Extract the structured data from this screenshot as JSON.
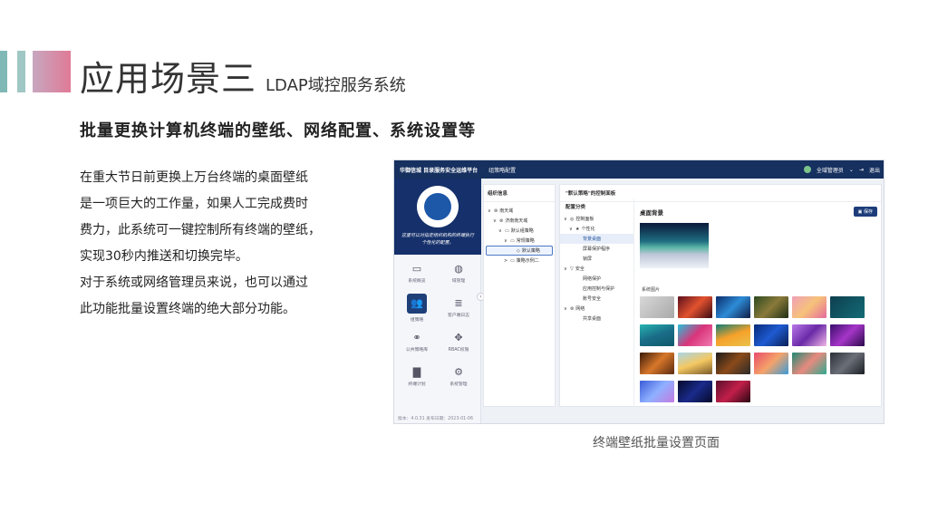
{
  "slide": {
    "title": "应用场景三",
    "title_sub": "LDAP域控服务系统",
    "subtitle": "批量更换计算机终端的壁纸、网络配置、系统设置等",
    "paragraphs": [
      "在重大节日前更换上万台终端的桌面壁纸",
      "是一项巨大的工作量，如果人工完成费时",
      "费力，此系统可一键控制所有终端的壁纸，",
      "实现30秒内推送和切换完毕。",
      "对于系统或网络管理员来说，也可以通过",
      "此功能批量设置终端的绝大部分功能。"
    ],
    "caption": "终端壁纸批量设置页面"
  },
  "app": {
    "brand": "华御信城   目录服务安全运维平台",
    "active_tab": "组策略配置",
    "user": "全域管理员",
    "logout": "退出",
    "slogan": "这里可以对指定组织机构的终端执行个性化的配置。",
    "nav": [
      {
        "icon": "monitor-icon",
        "glyph": "▭",
        "label": "系统概览",
        "active": false
      },
      {
        "icon": "globe-icon",
        "glyph": "◍",
        "label": "域管理",
        "active": false
      },
      {
        "icon": "users-icon",
        "glyph": "👥",
        "label": "组策略",
        "active": true
      },
      {
        "icon": "list-icon",
        "glyph": "≣",
        "label": "客户端日志",
        "active": false
      },
      {
        "icon": "cluster-icon",
        "glyph": "⚭",
        "label": "公共策略库",
        "active": false
      },
      {
        "icon": "move-icon",
        "glyph": "✥",
        "label": "RBAC权限",
        "active": false
      },
      {
        "icon": "file-icon",
        "glyph": "▇",
        "label": "终端计划",
        "active": false
      },
      {
        "icon": "gear-icon",
        "glyph": "⚙",
        "label": "系统管理",
        "active": false
      }
    ],
    "version": "版本：4.0.31   发布日期：2023-01-06",
    "tree_title": "组织信息",
    "tree": [
      {
        "indent": 0,
        "arrow": "∨",
        "icon": "⊜",
        "label": "南天域",
        "selected": false
      },
      {
        "indent": 1,
        "arrow": "∨",
        "icon": "⊜",
        "label": "济南南天域",
        "selected": false
      },
      {
        "indent": 2,
        "arrow": "∨",
        "icon": "▭",
        "label": "默认组策略",
        "selected": false
      },
      {
        "indent": 3,
        "arrow": "∨",
        "icon": "▭",
        "label": "常规策略",
        "selected": false
      },
      {
        "indent": 4,
        "arrow": "",
        "icon": "◇",
        "label": "默认策略",
        "selected": true
      },
      {
        "indent": 3,
        "arrow": ">",
        "icon": "▭",
        "label": "策略示例二",
        "selected": false
      }
    ],
    "panel_title": "\"默认策略\"的控制面板",
    "cfg_header": "配置分类",
    "cfg_items": [
      {
        "indent": 0,
        "arrow": "∨",
        "icon": "◎",
        "label": "控制面板",
        "selected": false
      },
      {
        "indent": 1,
        "arrow": "∨",
        "icon": "★",
        "label": "个性化",
        "selected": false
      },
      {
        "indent": 2,
        "arrow": "",
        "icon": "",
        "label": "背景桌面",
        "selected": true
      },
      {
        "indent": 2,
        "arrow": "",
        "icon": "",
        "label": "屏幕保护程序",
        "selected": false
      },
      {
        "indent": 2,
        "arrow": "",
        "icon": "",
        "label": "锁屏",
        "selected": false
      },
      {
        "indent": 0,
        "arrow": "∨",
        "icon": "▽",
        "label": "安全",
        "selected": false
      },
      {
        "indent": 2,
        "arrow": "",
        "icon": "",
        "label": "网络保护",
        "selected": false
      },
      {
        "indent": 2,
        "arrow": "",
        "icon": "",
        "label": "应用控制与保护",
        "selected": false
      },
      {
        "indent": 2,
        "arrow": "",
        "icon": "",
        "label": "账号安全",
        "selected": false
      },
      {
        "indent": 0,
        "arrow": "∨",
        "icon": "⊜",
        "label": "网络",
        "selected": false
      },
      {
        "indent": 2,
        "arrow": "",
        "icon": "",
        "label": "共享桌面",
        "selected": false
      }
    ],
    "detail_title": "桌面背景",
    "save_label": "保存",
    "system_images_label": "系统图片",
    "thumbs": [
      {
        "name": "wallpaper-grey",
        "bg": "linear-gradient(135deg,#d8d8d8,#a9a9a9)"
      },
      {
        "name": "wallpaper-red-geometric",
        "bg": "linear-gradient(135deg,#5b0f1c,#e2522f,#3a0a12)"
      },
      {
        "name": "wallpaper-blue-wave",
        "bg": "linear-gradient(135deg,#0c2c6b,#2d8bd6,#0f1c45)"
      },
      {
        "name": "wallpaper-forest",
        "bg": "linear-gradient(135deg,#2d4a1f,#8a7a3a,#1f2f14)"
      },
      {
        "name": "wallpaper-pink-abstract",
        "bg": "linear-gradient(135deg,#f0a0b8,#f6c27a,#e56a9c)"
      },
      {
        "name": "wallpaper-teal-dark",
        "bg": "linear-gradient(135deg,#0e3f4f,#136b76)"
      },
      {
        "name": "wallpaper-teal-mountain",
        "bg": "linear-gradient(160deg,#27b4b0,#1a6d88,#0e5a6a)"
      },
      {
        "name": "wallpaper-magenta-ribbon",
        "bg": "linear-gradient(135deg,#25c1d8,#d9347a,#f07bb0)"
      },
      {
        "name": "wallpaper-orange-curve",
        "bg": "linear-gradient(160deg,#0f7d77,#f6a12a,#e9c34b)"
      },
      {
        "name": "wallpaper-cobalt",
        "bg": "linear-gradient(135deg,#0a2a7a,#1e5bd1,#091f55)"
      },
      {
        "name": "wallpaper-violet-swirl",
        "bg": "linear-gradient(135deg,#b978e8,#6a2aa8,#f0b6e6)"
      },
      {
        "name": "wallpaper-purple-flower",
        "bg": "linear-gradient(135deg,#3b0f6b,#a535c8,#2a0a4a)"
      },
      {
        "name": "wallpaper-canyon",
        "bg": "linear-gradient(135deg,#3a1a0a,#d7772a,#5a2a10)"
      },
      {
        "name": "wallpaper-beach-chairs",
        "bg": "linear-gradient(160deg,#a9d6e8,#f4c862,#7a5a2a)"
      },
      {
        "name": "wallpaper-sunset-tree",
        "bg": "linear-gradient(135deg,#1b1b1b,#8a4a1a,#2a2a2a)"
      },
      {
        "name": "wallpaper-coral-wave",
        "bg": "linear-gradient(135deg,#e94b6a,#f4a36a,#3a9bd8)"
      },
      {
        "name": "wallpaper-green-triangles",
        "bg": "linear-gradient(135deg,#1f8a73,#e88a7e,#2ea98e)"
      },
      {
        "name": "wallpaper-road",
        "bg": "linear-gradient(135deg,#2a2f38,#6a6f78,#1b1e24)"
      },
      {
        "name": "wallpaper-blue-gradient",
        "bg": "linear-gradient(135deg,#3a5bd8,#8fb0ff,#c37be0)"
      },
      {
        "name": "wallpaper-dark-glow",
        "bg": "linear-gradient(135deg,#050a2a,#1a2a8a,#050a2a)"
      },
      {
        "name": "wallpaper-crimson-flow",
        "bg": "linear-gradient(135deg,#5a0f2a,#c21f4a,#2a0612)"
      }
    ]
  },
  "colors": {
    "topbar": "#16305f",
    "accent": "#1d3d7a",
    "deco_teal": "#7fb8b4",
    "deco_pink": "#e07a96"
  }
}
